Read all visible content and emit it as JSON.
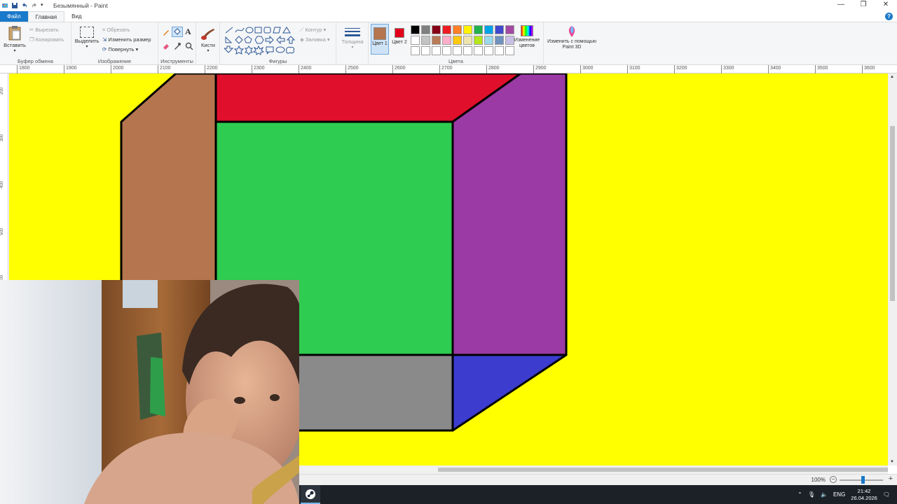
{
  "window": {
    "title": "Безымянный - Paint",
    "controls": [
      "—",
      "❐",
      "✕"
    ]
  },
  "tabs": [
    {
      "label": "Файл"
    },
    {
      "label": "Главная"
    },
    {
      "label": "Вид"
    }
  ],
  "ribbon": {
    "clipboard": {
      "paste": "Вставить",
      "cut": "Вырезать",
      "copy": "Копировать",
      "group": "Буфер обмена"
    },
    "image": {
      "select": "Выделить",
      "crop": "Обрезать",
      "resize": "Изменить размер",
      "rotate": "Повернуть",
      "group": "Изображение"
    },
    "tools": {
      "group": "Инструменты",
      "brushes": "Кисти"
    },
    "shapes": {
      "outline": "Контур",
      "fill": "Заливка",
      "group": "Фигуры"
    },
    "size": "Толщина",
    "color1": "Цвет 1",
    "color2": "Цвет 2",
    "color1_value": "#b5754f",
    "color2_value": "#e3001b",
    "colors_group": "Цвета",
    "edit_colors": "Изменение цветов",
    "paint3d": "Изменить с помощью Paint 3D",
    "palette_row1": [
      "#000000",
      "#7f7f7f",
      "#880015",
      "#ed1c24",
      "#ff7f27",
      "#fff200",
      "#22b14c",
      "#00a2e8",
      "#3f48cc",
      "#a349a4"
    ],
    "palette_row2": [
      "#ffffff",
      "#c3c3c3",
      "#b97a57",
      "#ffaec9",
      "#ffc90e",
      "#efe4b0",
      "#b5e61d",
      "#99d9ea",
      "#7092be",
      "#c8bfe7"
    ]
  },
  "ruler": {
    "h_ticks": [
      "1800",
      "1900",
      "2000",
      "2100",
      "2200",
      "2300",
      "2400",
      "2500",
      "2600",
      "2700",
      "2800",
      "2900",
      "3000",
      "3100",
      "3200",
      "3300",
      "3400",
      "3500",
      "3600"
    ],
    "v_ticks": [
      "200",
      "300",
      "400",
      "500",
      "600"
    ]
  },
  "canvas": {
    "background": "#ffff00",
    "colors": {
      "brown": "#b5754f",
      "red": "#e00f2b",
      "green": "#2ecc50",
      "purple": "#9b3aa4",
      "gray": "#8a8a8a",
      "blue": "#3c3ccf"
    }
  },
  "status": {
    "zoom": "100%"
  },
  "taskbar": {
    "lang": "ENG",
    "time": "21:42",
    "date": "26.04.2026"
  }
}
